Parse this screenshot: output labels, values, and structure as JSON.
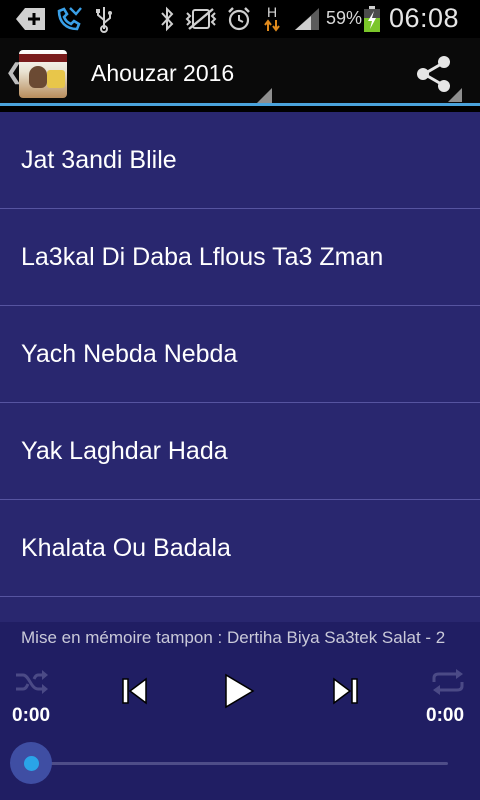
{
  "status_bar": {
    "battery_percent": "59%",
    "time": "06:08",
    "network_type": "H",
    "icons": [
      "add-icon",
      "missed-call-icon",
      "usb-icon",
      "bluetooth-icon",
      "vibrate-icon",
      "alarm-icon",
      "data-transfer-icon",
      "signal-icon",
      "battery-charging-icon"
    ]
  },
  "action_bar": {
    "title": "Ahouzar 2016",
    "icons": [
      "back-chevron-icon",
      "app-logo",
      "share-icon"
    ]
  },
  "songs": [
    {
      "title": "Jat 3andi Blile"
    },
    {
      "title": "La3kal Di Daba Lflous Ta3 Zman"
    },
    {
      "title": "Yach Nebda Nebda"
    },
    {
      "title": "Yak Laghdar Hada"
    },
    {
      "title": "Khalata Ou Badala"
    }
  ],
  "player": {
    "status_text": "Mise en mémoire tampon : Dertiha Biya Sa3tek Salat - 2",
    "elapsed": "0:00",
    "duration": "0:00",
    "progress": 0,
    "controls": [
      "shuffle-icon",
      "previous-icon",
      "play-icon",
      "next-icon",
      "repeat-icon"
    ]
  }
}
